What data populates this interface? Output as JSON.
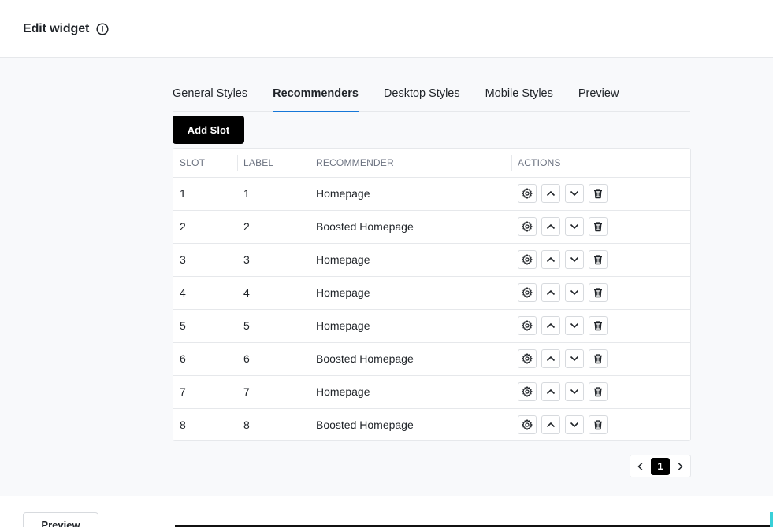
{
  "header": {
    "title": "Edit widget",
    "info_icon": "info-circle-icon"
  },
  "tabs": [
    {
      "label": "General Styles",
      "active": false
    },
    {
      "label": "Recommenders",
      "active": true
    },
    {
      "label": "Desktop Styles",
      "active": false
    },
    {
      "label": "Mobile Styles",
      "active": false
    },
    {
      "label": "Preview",
      "active": false
    }
  ],
  "add_slot_label": "Add Slot",
  "table": {
    "columns": [
      "SLOT",
      "LABEL",
      "RECOMMENDER",
      "ACTIONS"
    ],
    "rows": [
      {
        "slot": "1",
        "label": "1",
        "recommender": "Homepage"
      },
      {
        "slot": "2",
        "label": "2",
        "recommender": "Boosted Homepage"
      },
      {
        "slot": "3",
        "label": "3",
        "recommender": "Homepage"
      },
      {
        "slot": "4",
        "label": "4",
        "recommender": "Homepage"
      },
      {
        "slot": "5",
        "label": "5",
        "recommender": "Homepage"
      },
      {
        "slot": "6",
        "label": "6",
        "recommender": "Boosted Homepage"
      },
      {
        "slot": "7",
        "label": "7",
        "recommender": "Homepage"
      },
      {
        "slot": "8",
        "label": "8",
        "recommender": "Boosted Homepage"
      }
    ],
    "row_actions": [
      "gear-icon",
      "chevron-up-icon",
      "chevron-down-icon",
      "trash-icon"
    ]
  },
  "pagination": {
    "current_page": "1"
  },
  "footer": {
    "preview_label": "Preview"
  },
  "colors": {
    "accent": "#1677d8",
    "primary_button": "#000000",
    "background": "#f8f9fb"
  }
}
